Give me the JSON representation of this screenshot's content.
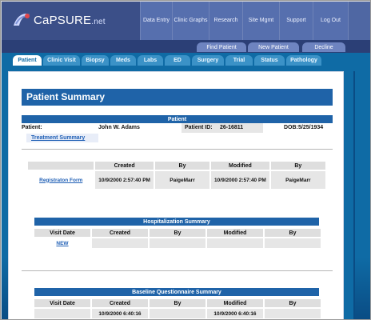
{
  "brand": {
    "logo_text_main": "CaPSURE",
    "logo_text_suffix": ".net"
  },
  "top_nav": [
    {
      "label": "Data Entry"
    },
    {
      "label": "Clinic Graphs"
    },
    {
      "label": "Research"
    },
    {
      "label": "Site Mgmt"
    },
    {
      "label": "Support"
    },
    {
      "label": "Log Out"
    }
  ],
  "actions": [
    {
      "label": "Find Patient"
    },
    {
      "label": "New Patient"
    },
    {
      "label": "Decline"
    }
  ],
  "tabs": [
    {
      "label": "Patient",
      "active": true
    },
    {
      "label": "Clinic Visit"
    },
    {
      "label": "Biopsy"
    },
    {
      "label": "Meds"
    },
    {
      "label": "Labs"
    },
    {
      "label": "ED"
    },
    {
      "label": "Surgery"
    },
    {
      "label": "Trial"
    },
    {
      "label": "Status"
    },
    {
      "label": "Pathology"
    }
  ],
  "page": {
    "title": "Patient Summary"
  },
  "patient_section": {
    "header": "Patient",
    "patient_label": "Patient:",
    "patient_name": "John W. Adams",
    "patient_id_label": "Patient ID:",
    "patient_id": "26-16811",
    "dob_label": "DOB:",
    "dob": "5/25/1934",
    "treatment_summary_link": "Treatment Summary"
  },
  "registration_table": {
    "columns": [
      "",
      "Created",
      "By",
      "Modified",
      "By"
    ],
    "row": {
      "link": "Registraton Form",
      "created": "10/9/2000 2:57:40 PM",
      "created_by": "PaigeMarr",
      "modified": "10/9/2000 2:57:40 PM",
      "modified_by": "PaigeMarr"
    }
  },
  "hospitalization_summary": {
    "header": "Hospitalization Summary",
    "columns": [
      "Visit Date",
      "Created",
      "By",
      "Modified",
      "By"
    ],
    "row": {
      "link": "NEW"
    }
  },
  "baseline_questionnaire_summary": {
    "header": "Baseline Questionnaire Summary",
    "columns": [
      "Visit Date",
      "Created",
      "By",
      "Modified",
      "By"
    ],
    "partial_row": {
      "created": "10/9/2000 6:40:16",
      "modified": "10/9/2000 6:40:16"
    }
  },
  "colors": {
    "primary_blue": "#0f6ba5",
    "section_header_blue": "#1f63a8",
    "top_nav_blue": "#4f67a3",
    "link_blue": "#1f5fb5"
  }
}
